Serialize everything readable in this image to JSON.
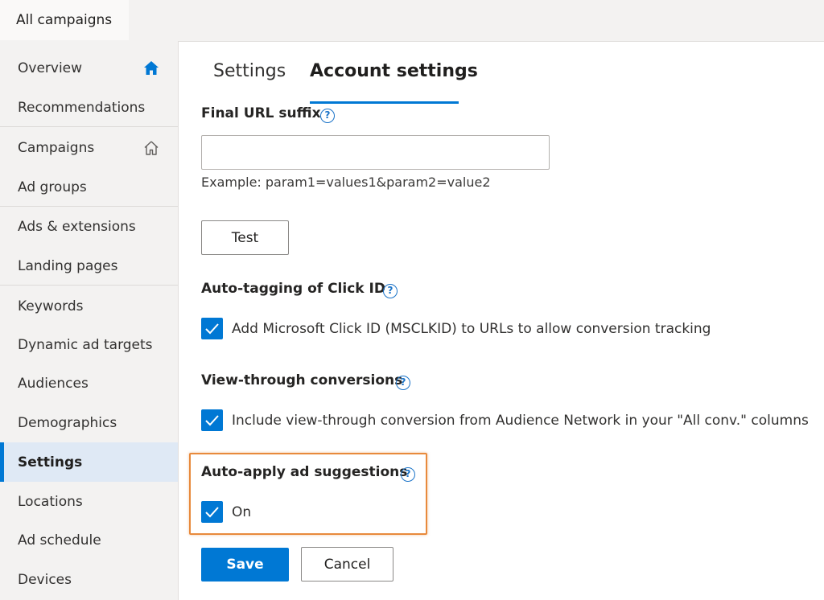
{
  "header": {
    "scope_label": "All campaigns"
  },
  "sidebar": {
    "items": [
      {
        "label": "Overview",
        "icon": "home-filled-icon"
      },
      {
        "label": "Recommendations"
      },
      {
        "label": "Campaigns",
        "icon": "home-outline-icon"
      },
      {
        "label": "Ad groups"
      },
      {
        "label": "Ads & extensions"
      },
      {
        "label": "Landing pages"
      },
      {
        "label": "Keywords"
      },
      {
        "label": "Dynamic ad targets"
      },
      {
        "label": "Audiences"
      },
      {
        "label": "Demographics"
      },
      {
        "label": "Settings",
        "selected": true
      },
      {
        "label": "Locations"
      },
      {
        "label": "Ad schedule"
      },
      {
        "label": "Devices"
      }
    ]
  },
  "tabs": [
    {
      "label": "Settings",
      "active": false
    },
    {
      "label": "Account settings",
      "active": true
    }
  ],
  "form": {
    "final_url_suffix": {
      "label": "Final URL suffix",
      "value": "",
      "hint": "Example: param1=values1&param2=value2"
    },
    "test_button": "Test",
    "auto_tagging": {
      "label": "Auto-tagging of Click ID",
      "checkbox_label": "Add Microsoft Click ID (MSCLKID) to URLs to allow conversion tracking",
      "checked": true
    },
    "view_through": {
      "label": "View-through conversions",
      "checkbox_label": "Include view-through conversion from Audience Network in your \"All conv.\" columns",
      "checked": true
    },
    "auto_apply": {
      "label": "Auto-apply ad suggestions",
      "checkbox_label": "On",
      "checked": true
    },
    "save_button": "Save",
    "cancel_button": "Cancel",
    "help_glyph": "?"
  },
  "colors": {
    "accent": "#0078d4",
    "highlight_border": "#e88a3c",
    "sidebar_bg": "#f3f2f1",
    "selected_bg": "#dfe9f5"
  }
}
